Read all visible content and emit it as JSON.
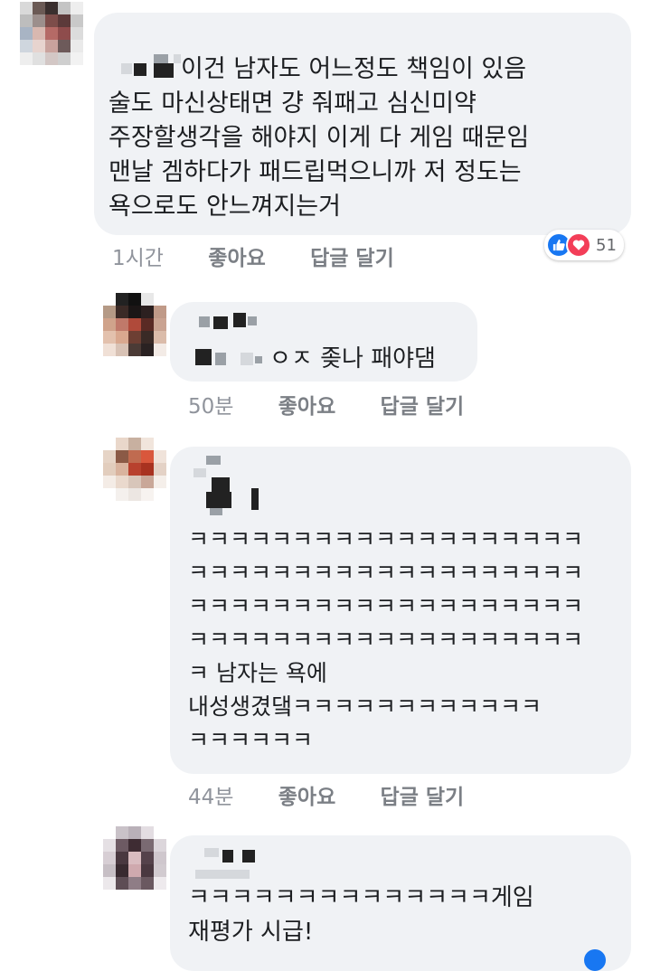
{
  "comments": [
    {
      "text": "이건 남자도 어느정도 책임이 있음\n술도 마신상태면 걍 줘패고 심신미약\n주장할생각을 해야지 이게 다 게임 때문임\n맨날 겜하다가 패드립먹으니까 저 정도는\n욕으로도 안느껴지는거",
      "time": "1시간",
      "like_label": "좋아요",
      "reply_label": "답글 달기",
      "reaction_count": "51"
    },
    {
      "text": "ㅇㅈ 좆나 패야댐",
      "time": "50분",
      "like_label": "좋아요",
      "reply_label": "답글 달기"
    },
    {
      "text": "ㅋㅋㅋㅋㅋㅋㅋㅋㅋㅋㅋㅋㅋㅋㅋㅋㅋㅋㅋ\nㅋㅋㅋㅋㅋㅋㅋㅋㅋㅋㅋㅋㅋㅋㅋㅋㅋㅋㅋ\nㅋㅋㅋㅋㅋㅋㅋㅋㅋㅋㅋㅋㅋㅋㅋㅋㅋㅋㅋ\nㅋㅋㅋㅋㅋㅋㅋㅋㅋㅋㅋㅋㅋㅋㅋㅋㅋㅋㅋ\nㅋ 남자는 욕에\n내성생겼댘ㅋㅋㅋㅋㅋㅋㅋㅋㅋㅋㅋㅋ\nㅋㅋㅋㅋㅋㅋ",
      "time": "44분",
      "like_label": "좋아요",
      "reply_label": "답글 달기"
    },
    {
      "text": "ㅋㅋㅋㅋㅋㅋㅋㅋㅋㅋㅋㅋㅋㅋ게임\n재평가 시급!"
    }
  ],
  "colors": {
    "bubble": "#f0f2f5",
    "meta": "#90949c",
    "like": "#1877f2",
    "love": "#f33e58"
  },
  "icons": {
    "like": "thumbs-up-icon",
    "love": "heart-icon"
  }
}
